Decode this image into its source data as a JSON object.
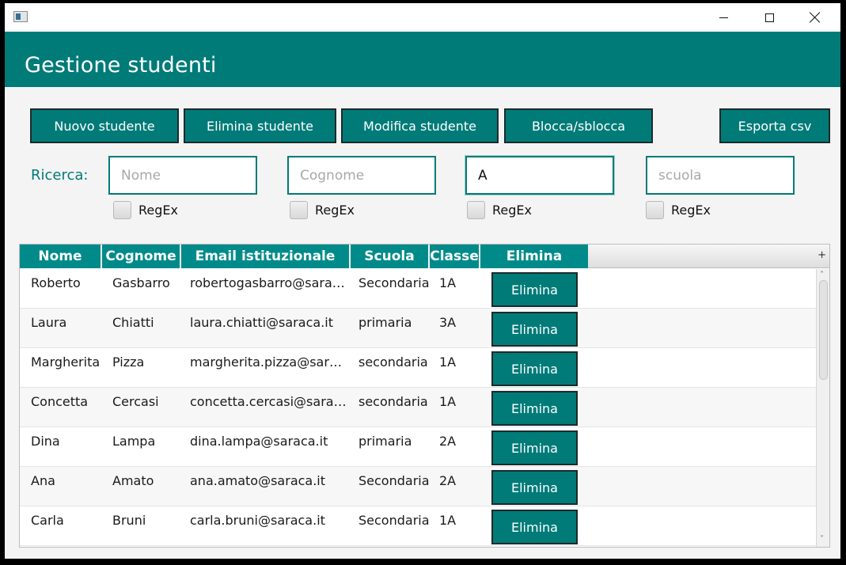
{
  "window": {
    "app_icon": "window-app-icon"
  },
  "header": {
    "title": "Gestione studenti"
  },
  "toolbar": {
    "new_label": "Nuovo studente",
    "delete_label": "Elimina studente",
    "edit_label": "Modifica studente",
    "lock_label": "Blocca/sblocca",
    "export_label": "Esporta csv"
  },
  "search": {
    "label": "Ricerca:",
    "nome_placeholder": "Nome",
    "cognome_placeholder": "Cognome",
    "classe_value": "A",
    "scuola_placeholder": "scuola",
    "regex_label": "RegEx"
  },
  "table": {
    "columns": [
      "Nome",
      "Cognome",
      "Email istituzionale",
      "Scuola",
      "Classe",
      "Elimina"
    ],
    "delete_label": "Elimina",
    "rows": [
      {
        "nome": "Roberto",
        "cognome": "Gasbarro",
        "email": "robertogasbarro@saraca.it",
        "scuola": "Secondaria",
        "classe": "1A"
      },
      {
        "nome": "Laura",
        "cognome": "Chiatti",
        "email": "laura.chiatti@saraca.it",
        "scuola": "primaria",
        "classe": "3A"
      },
      {
        "nome": "Margherita",
        "cognome": "Pizza",
        "email": "margherita.pizza@saraca.it",
        "scuola": "secondaria",
        "classe": "1A"
      },
      {
        "nome": "Concetta",
        "cognome": "Cercasi",
        "email": "concetta.cercasi@saraca.it",
        "scuola": "secondaria",
        "classe": "1A"
      },
      {
        "nome": "Dina",
        "cognome": "Lampa",
        "email": "dina.lampa@saraca.it",
        "scuola": "primaria",
        "classe": "2A"
      },
      {
        "nome": "Ana",
        "cognome": "Amato",
        "email": "ana.amato@saraca.it",
        "scuola": "Secondaria",
        "classe": "2A"
      },
      {
        "nome": "Carla",
        "cognome": "Bruni",
        "email": "carla.bruni@saraca.it",
        "scuola": "Secondaria",
        "classe": "1A"
      }
    ]
  },
  "colors": {
    "accent": "#007b78",
    "header_cell": "#008b8a"
  }
}
